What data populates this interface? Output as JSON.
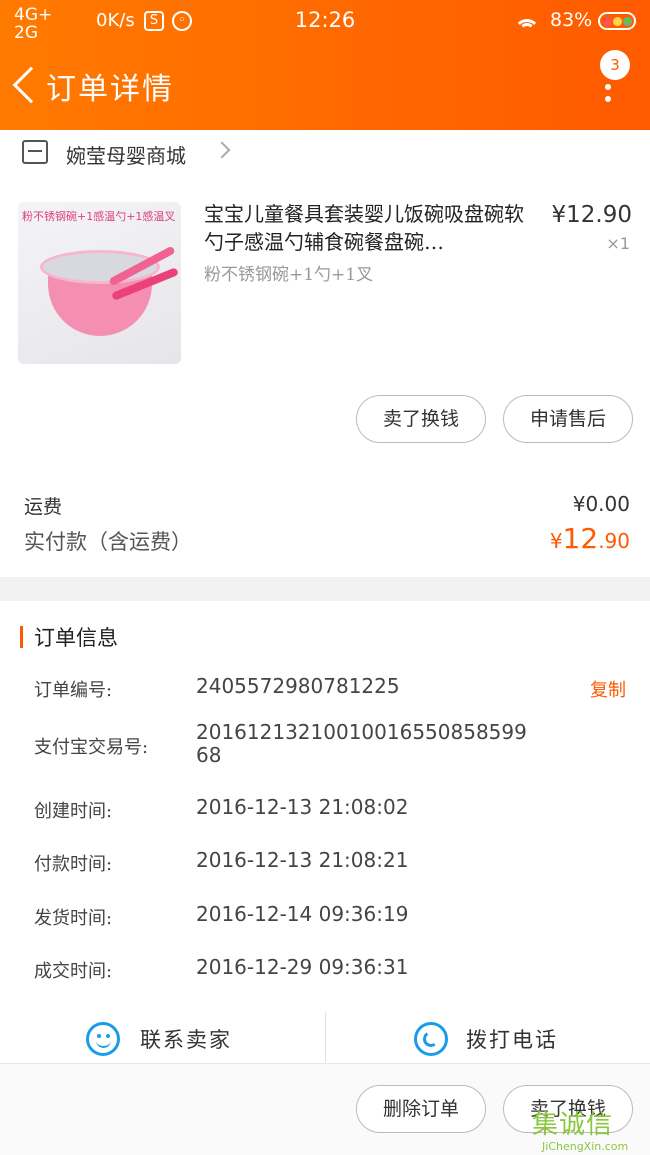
{
  "status_bar": {
    "network_top": "4G+",
    "network_bottom": "2G",
    "speed": "0K/s",
    "time": "12:26",
    "battery": "83%"
  },
  "nav": {
    "title": "订单详情",
    "notification_count": "3"
  },
  "shop": {
    "name": "婉莹母婴商城"
  },
  "product": {
    "title": "宝宝儿童餐具套装婴儿饭碗吸盘碗软勺子感温勺辅食碗餐盘碗…",
    "sku": "粉不锈钢碗+1勺+1叉",
    "price": "¥12.90",
    "quantity": "×1",
    "thumbnail_caption": "粉不锈钢碗+1感温勺+1感温叉"
  },
  "item_actions": {
    "sell_label": "卖了换钱",
    "aftersale_label": "申请售后"
  },
  "summary": {
    "shipping_label": "运费",
    "shipping_value": "¥0.00",
    "total_label": "实付款（含运费）",
    "total_currency": "¥",
    "total_integer": "12",
    "total_decimal": ".90"
  },
  "order_info": {
    "title": "订单信息",
    "copy_label": "复制",
    "rows": [
      {
        "label": "订单编号:",
        "value": "2405572980781225"
      },
      {
        "label": "支付宝交易号:",
        "value": "20161213210010016550858599 68"
      },
      {
        "label": "创建时间:",
        "value": "2016-12-13 21:08:02"
      },
      {
        "label": "付款时间:",
        "value": "2016-12-13 21:08:21"
      },
      {
        "label": "发货时间:",
        "value": "2016-12-14 09:36:19"
      },
      {
        "label": "成交时间:",
        "value": "2016-12-29 09:36:31"
      }
    ]
  },
  "contact": {
    "seller_label": "联系卖家",
    "call_label": "拨打电话"
  },
  "bottom_actions": {
    "delete_label": "删除订单",
    "sell_label": "卖了换钱"
  },
  "watermark": {
    "text": "集诚信",
    "url": "JiChengXin.com"
  },
  "colors": {
    "accent": "#ff5a00",
    "link_blue": "#1a9de8"
  }
}
